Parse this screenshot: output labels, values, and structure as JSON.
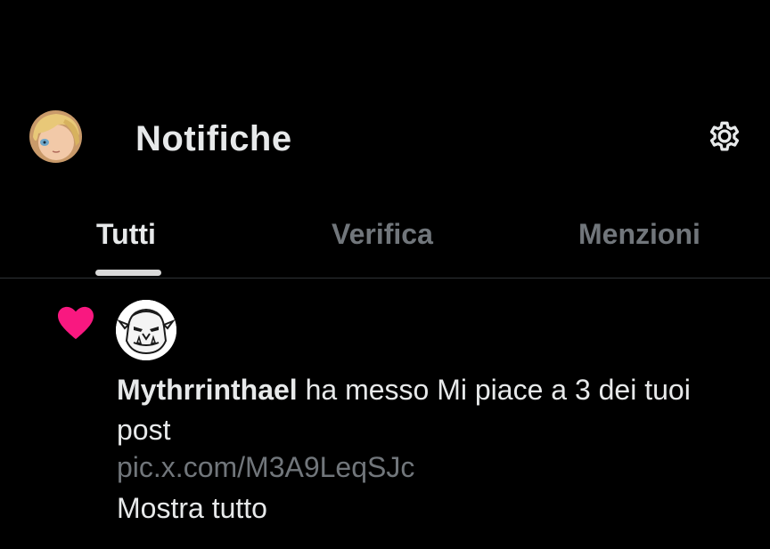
{
  "header": {
    "title": "Notifiche",
    "avatar_icon": "user-avatar-anime-icon",
    "settings_icon": "gear-icon"
  },
  "tabs": [
    {
      "label": "Tutti",
      "active": true
    },
    {
      "label": "Verifica",
      "active": false
    },
    {
      "label": "Menzioni",
      "active": false
    }
  ],
  "notification": {
    "type_icon": "heart-icon",
    "avatar_icon": "orc-avatar-icon",
    "user": "Mythrrinthael",
    "message": " ha messo Mi piace a 3 dei tuoi post",
    "link": "pic.x.com/M3A9LeqSJc",
    "show_all": "Mostra tutto"
  },
  "colors": {
    "background": "#000000",
    "text_primary": "#e7e9ea",
    "text_secondary": "#71767b",
    "like_pink": "#f91880",
    "divider": "#2f3336"
  }
}
